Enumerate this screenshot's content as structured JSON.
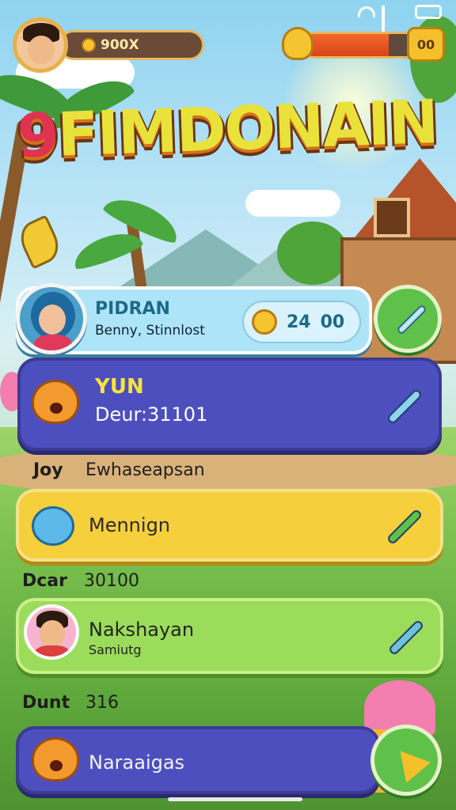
{
  "header": {
    "coins": "900X",
    "energy_count": "00",
    "energy_level_pct": 70
  },
  "title": {
    "first": "9",
    "rest": "FIMDONAIN"
  },
  "players": {
    "featured": {
      "name": "PIDRAN",
      "subtitle": "Benny, Stinnlost",
      "score_a": "24",
      "score_b": "00"
    },
    "second": {
      "name": "YUN",
      "subtitle": "Deur:31101"
    },
    "row1": {
      "label": "Joy",
      "value": "Ewhaseapsan"
    },
    "third": {
      "name": "Mennign"
    },
    "row2": {
      "label": "Dcar",
      "value": "30100"
    },
    "fourth": {
      "name": "Nakshayan",
      "subtitle": "Samiutg"
    },
    "row3": {
      "label": "Dunt",
      "value": "316"
    },
    "fifth": {
      "name": "Naraaigas"
    }
  },
  "colors": {
    "accent_yellow": "#f6cf3c",
    "accent_purple": "#4e4fbf",
    "accent_green": "#9bdc5a",
    "accent_blue": "#aee4f7"
  }
}
